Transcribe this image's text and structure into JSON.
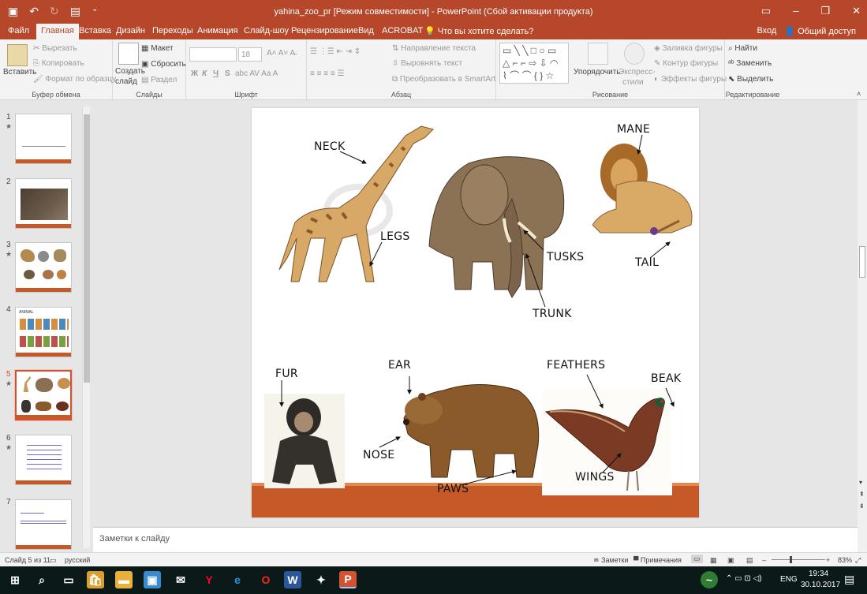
{
  "titlebar": {
    "title": "yahina_zoo_pr [Режим совместимости] - PowerPoint (Сбой активации продукта)",
    "save_icon": "save-icon",
    "undo_icon": "undo-icon",
    "redo_icon": "redo-icon",
    "slideshow_icon": "present-icon"
  },
  "menu": {
    "tabs": [
      "Файл",
      "Главная",
      "Вставка",
      "Дизайн",
      "Переходы",
      "Анимация",
      "Слайд-шоу",
      "Рецензирование",
      "Вид",
      "ACROBAT"
    ],
    "search": "Что вы хотите сделать?",
    "signin": "Вход",
    "share": "Общий доступ"
  },
  "ribbon": {
    "paste": "Вставить",
    "cut": "Вырезать",
    "copy": "Копировать",
    "format_painter": "Формат по образцу",
    "clipboard_group": "Буфер обмена",
    "new_slide_1": "Создать",
    "new_slide_2": "слайд",
    "layout": "Макет",
    "reset": "Сбросить",
    "section": "Раздел",
    "slides_group": "Слайды",
    "font_size": "18",
    "font_group": "Шрифт",
    "bold": "Ж",
    "italic": "К",
    "underline": "Ч",
    "strike": "S",
    "text_direction": "Направление текста",
    "align_text": "Выровнять текст",
    "smartart": "Преобразовать в SmartArt",
    "paragraph_group": "Абзац",
    "arrange": "Упорядочить",
    "quick_styles_1": "Экспресс-",
    "quick_styles_2": "стили",
    "shape_fill": "Заливка фигуры",
    "shape_outline": "Контур фигуры",
    "shape_effects": "Эффекты фигуры",
    "drawing_group": "Рисование",
    "find": "Найти",
    "replace": "Заменить",
    "select": "Выделить",
    "editing_group": "Редактирование"
  },
  "thumbnails": [
    {
      "num": "1",
      "star": "★"
    },
    {
      "num": "2",
      "star": ""
    },
    {
      "num": "3",
      "star": "★"
    },
    {
      "num": "4",
      "star": ""
    },
    {
      "num": "5",
      "star": "★"
    },
    {
      "num": "6",
      "star": "★"
    },
    {
      "num": "7",
      "star": ""
    }
  ],
  "slide": {
    "labels": {
      "neck": "NECK",
      "legs": "LEGS",
      "tusks": "TUSKS",
      "trunk": "TRUNK",
      "mane": "MANE",
      "tail": "TAIL",
      "fur": "FUR",
      "ear": "EAR",
      "nose": "NOSE",
      "paws": "PAWS",
      "feathers": "FEATHERS",
      "beak": "BEAK",
      "wings": "WINGS"
    },
    "thumb4_title": "ANIMAL"
  },
  "notes": {
    "placeholder": "Заметки к слайду"
  },
  "status": {
    "slide_counter": "Слайд 5 из 11",
    "language": "русский",
    "notes_btn": "Заметки",
    "comments_btn": "Примечания",
    "zoom": "83%"
  },
  "taskbar": {
    "lang": "ENG",
    "time": "19:34",
    "date": "30.10.2017"
  },
  "colors": {
    "accent": "#b7472a",
    "slide_band": "#c55a28"
  }
}
